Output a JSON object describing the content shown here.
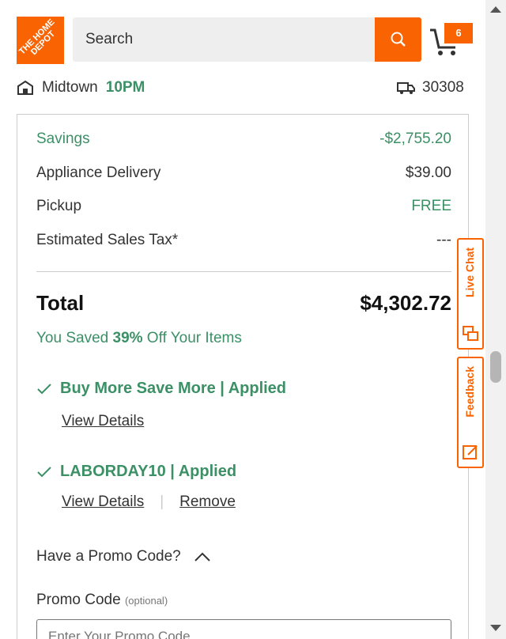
{
  "header": {
    "logo_text": "THE HOME DEPOT",
    "search_placeholder": "Search",
    "cart_count": "6",
    "store_name": "Midtown",
    "store_time": "10PM",
    "zip": "30308"
  },
  "summary": {
    "rows": [
      {
        "label": "Savings",
        "value": "-$2,755.20",
        "green": true
      },
      {
        "label": "Appliance Delivery",
        "value": "$39.00",
        "green": false
      },
      {
        "label": "Pickup",
        "value": "FREE",
        "green": false
      },
      {
        "label": "Estimated Sales Tax*",
        "value": "---",
        "green": false
      }
    ],
    "total_label": "Total",
    "total_value": "$4,302.72",
    "saved_prefix": "You Saved ",
    "saved_pct": "39%",
    "saved_suffix": " Off Your Items"
  },
  "promos": [
    {
      "title": "Buy More Save More | Applied",
      "details": "View Details"
    },
    {
      "title": "LABORDAY10 | Applied",
      "details": "View Details",
      "remove": "Remove"
    }
  ],
  "promo_code": {
    "question": "Have a Promo Code?",
    "label": "Promo Code",
    "optional": "(optional)",
    "placeholder": "Enter Your Promo Code"
  },
  "side_tabs": {
    "live_chat": "Live Chat",
    "feedback": "Feedback"
  },
  "colors": {
    "brand": "#f96302",
    "green": "#3b9066"
  }
}
